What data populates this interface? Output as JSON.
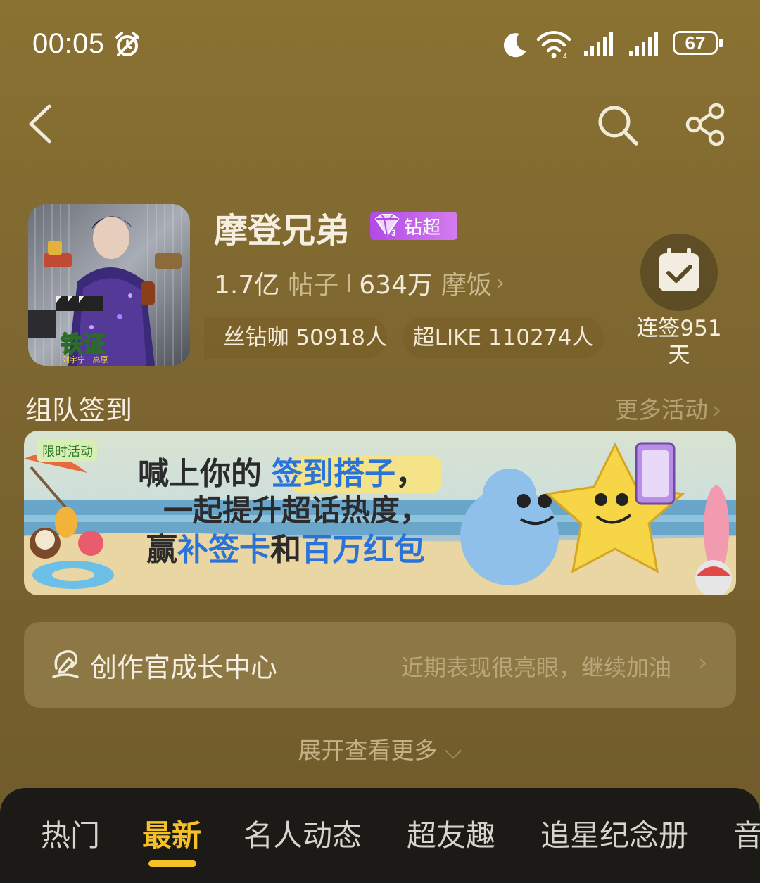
{
  "status_bar": {
    "time": "00:05",
    "battery": "67"
  },
  "header": {
    "title": "摩登兄弟",
    "badge": "钻超",
    "posts_count": "1.7亿",
    "posts_label": "帖子",
    "fans_count": "634万",
    "fans_label": "摩饭",
    "pill_1": "丝钻咖 50918人",
    "pill_2": "超LIKE 110274人",
    "signin_text": "连签951天"
  },
  "avatar": {
    "logo_text": "铁证",
    "caption": "刘宇宁 · 高原"
  },
  "section": {
    "title": "组队签到",
    "more": "更多活动"
  },
  "banner": {
    "tag": "限时活动",
    "line1_a": "喊上你的",
    "line1_b": "签到搭子",
    "line1_c": "，",
    "line2": "一起提升超话热度，",
    "line3_a": "赢",
    "line3_b": "补签卡",
    "line3_c": "和",
    "line3_d": "百万红包"
  },
  "creator": {
    "label": "创作官成长中心",
    "hint": "近期表现很亮眼，继续加油"
  },
  "expand": {
    "label": "展开查看更多"
  },
  "tabs": [
    {
      "label": "热门"
    },
    {
      "label": "最新"
    },
    {
      "label": "名人动态"
    },
    {
      "label": "超友趣"
    },
    {
      "label": "追星纪念册"
    },
    {
      "label": "音"
    }
  ],
  "colors": {
    "accent": "#f5c127",
    "background": "#7d6630",
    "badge": "#c45ee8"
  }
}
